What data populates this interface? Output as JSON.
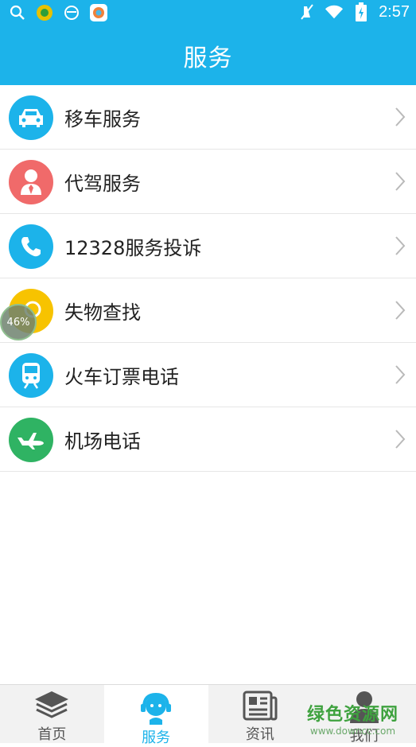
{
  "status": {
    "time": "2:57"
  },
  "header": {
    "title": "服务"
  },
  "items": [
    {
      "label": "移车服务",
      "icon": "car-icon",
      "color": "#1cb3ea"
    },
    {
      "label": "代驾服务",
      "icon": "person-tie-icon",
      "color": "#f06a6a"
    },
    {
      "label": "12328服务投诉",
      "icon": "phone-icon",
      "color": "#1cb3ea"
    },
    {
      "label": "失物查找",
      "icon": "search-circle-icon",
      "color": "#f7c300"
    },
    {
      "label": "火车订票电话",
      "icon": "train-icon",
      "color": "#1cb3ea"
    },
    {
      "label": "机场电话",
      "icon": "airplane-icon",
      "color": "#2fb363"
    }
  ],
  "overlay": {
    "progress_text": "46%"
  },
  "tabs": [
    {
      "label": "首页",
      "icon": "layers-icon"
    },
    {
      "label": "服务",
      "icon": "service-headset-icon",
      "active": true
    },
    {
      "label": "资讯",
      "icon": "newspaper-icon"
    },
    {
      "label": "我们",
      "icon": "user-icon"
    }
  ],
  "watermark": {
    "line1": "绿色资源网",
    "line2": "www.downcc.com"
  },
  "colors": {
    "accent": "#1cb3ea"
  }
}
